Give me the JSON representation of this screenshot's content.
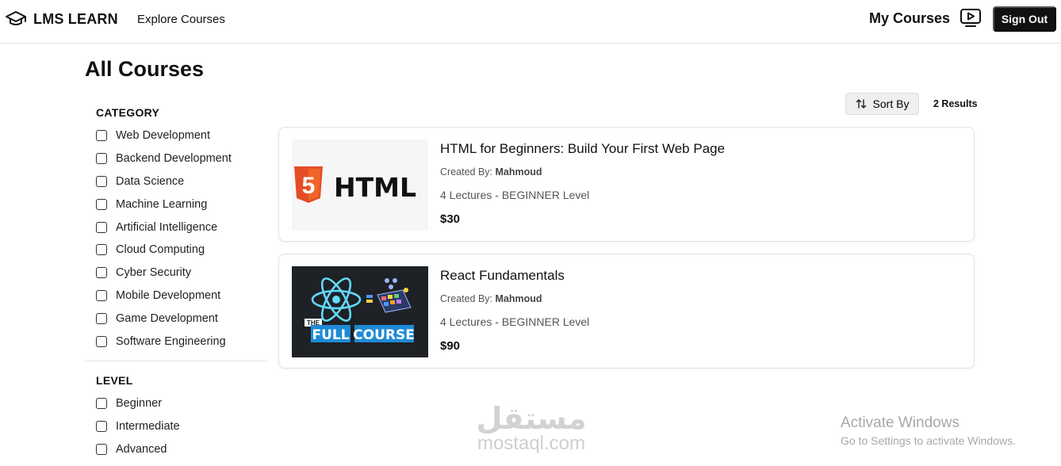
{
  "navbar": {
    "brand": "LMS LEARN",
    "explore": "Explore Courses",
    "my_courses": "My Courses",
    "sign_out": "Sign Out"
  },
  "page_title": "All Courses",
  "filters": {
    "category": {
      "title": "CATEGORY",
      "options": [
        "Web Development",
        "Backend Development",
        "Data Science",
        "Machine Learning",
        "Artificial Intelligence",
        "Cloud Computing",
        "Cyber Security",
        "Mobile Development",
        "Game Development",
        "Software Engineering"
      ]
    },
    "level": {
      "title": "LEVEL",
      "options": [
        "Beginner",
        "Intermediate",
        "Advanced"
      ]
    }
  },
  "toolbar": {
    "sort_label": "Sort By",
    "results": "2 Results"
  },
  "courses": [
    {
      "title": "HTML for Beginners: Build Your First Web Page",
      "created_by_label": "Created By: ",
      "author": "Mahmoud",
      "meta": "4 Lectures - BEGINNER Level",
      "price": "$30",
      "thumb_text": "HTML",
      "thumb_badge": "5"
    },
    {
      "title": "React Fundamentals",
      "created_by_label": "Created By: ",
      "author": "Mahmoud",
      "meta": "4 Lectures - BEGINNER Level",
      "price": "$90",
      "thumb_small": "THE",
      "thumb_word1": "FULL",
      "thumb_word2": "COURSE"
    }
  ],
  "watermark": {
    "arabic": "مستقل",
    "latin": "mostaql.com"
  },
  "activate": {
    "title": "Activate Windows",
    "subtitle": "Go to Settings to activate Windows."
  },
  "colors": {
    "primary": "#111111",
    "html_orange": "#e44d26",
    "react_blue": "#61dafb",
    "course_blue": "#1f8bd6"
  }
}
